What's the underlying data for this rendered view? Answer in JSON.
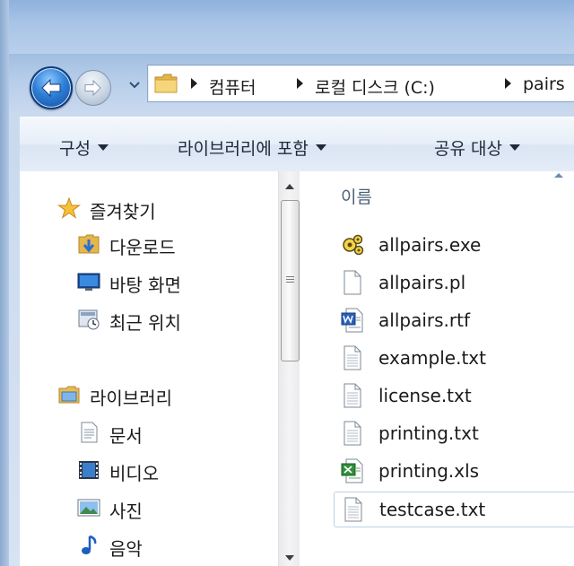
{
  "navigation": {
    "back_label": "뒤로",
    "forward_label": "앞으로",
    "breadcrumb": [
      "컴퓨터",
      "로컬 디스크 (C:)",
      "pairs"
    ]
  },
  "toolbar": {
    "organize_label": "구성",
    "include_in_library_label": "라이브러리에 포함",
    "share_with_label": "공유 대상"
  },
  "nav_pane": {
    "favorites": {
      "label": "즐겨찾기",
      "items": [
        {
          "label": "다운로드",
          "icon": "downloads-folder-icon"
        },
        {
          "label": "바탕 화면",
          "icon": "desktop-icon"
        },
        {
          "label": "최근 위치",
          "icon": "recent-places-icon"
        }
      ]
    },
    "libraries": {
      "label": "라이브러리",
      "items": [
        {
          "label": "문서",
          "icon": "documents-icon"
        },
        {
          "label": "비디오",
          "icon": "videos-icon"
        },
        {
          "label": "사진",
          "icon": "pictures-icon"
        },
        {
          "label": "음악",
          "icon": "music-icon"
        }
      ]
    }
  },
  "file_list": {
    "column_name": "이름",
    "files": [
      {
        "name": "allpairs.exe",
        "icon": "exe-icon"
      },
      {
        "name": "allpairs.pl",
        "icon": "blank-file-icon"
      },
      {
        "name": "allpairs.rtf",
        "icon": "word-document-icon"
      },
      {
        "name": "example.txt",
        "icon": "text-file-icon"
      },
      {
        "name": "license.txt",
        "icon": "text-file-icon"
      },
      {
        "name": "printing.txt",
        "icon": "text-file-icon"
      },
      {
        "name": "printing.xls",
        "icon": "excel-file-icon"
      },
      {
        "name": "testcase.txt",
        "icon": "text-file-icon",
        "selected": true
      }
    ]
  }
}
